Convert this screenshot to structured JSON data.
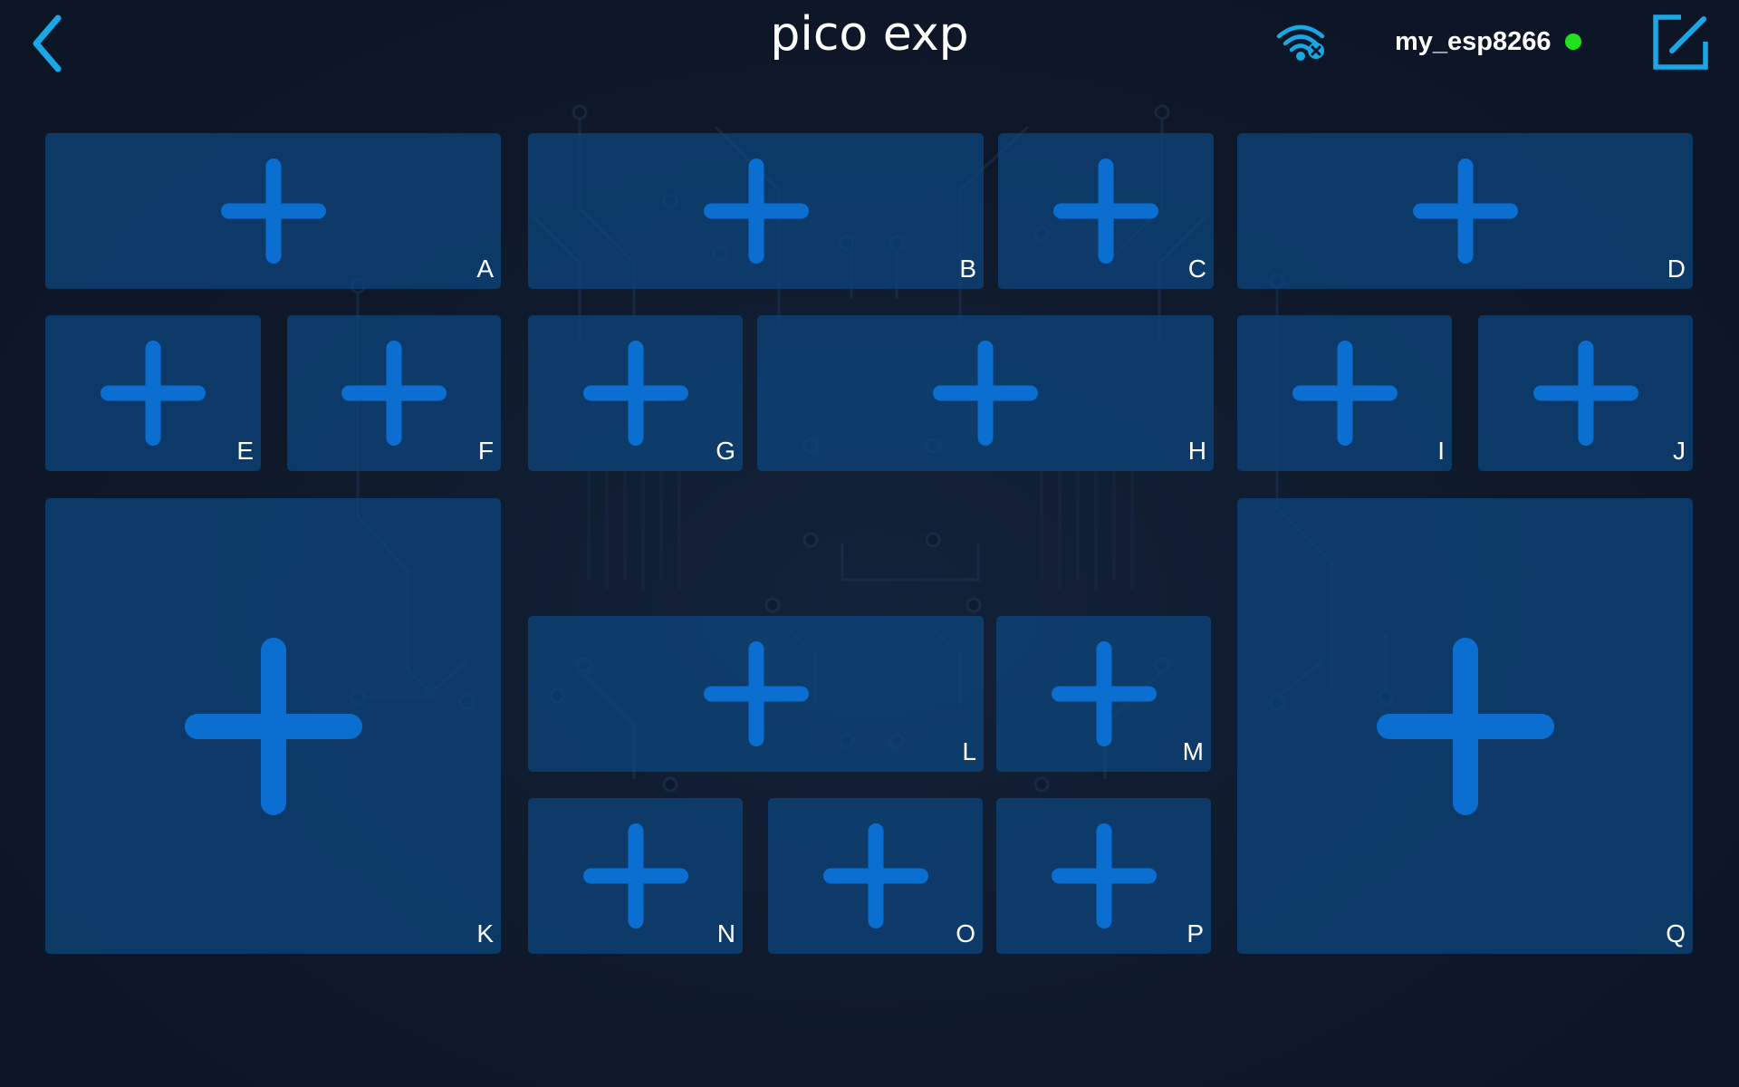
{
  "header": {
    "title": "pico exp",
    "device_name": "my_esp8266",
    "wifi_icon": "wifi-disconnected-icon",
    "back_icon": "chevron-left-icon",
    "edit_icon": "edit-square-icon"
  },
  "colors": {
    "background": "#0e1829",
    "slot": "#0c4680",
    "plus": "#0b6fd1",
    "accent": "#1aa7e6",
    "status_ok": "#1ee21a"
  },
  "slots": {
    "A": "A",
    "B": "B",
    "C": "C",
    "D": "D",
    "E": "E",
    "F": "F",
    "G": "G",
    "H": "H",
    "I": "I",
    "J": "J",
    "K": "K",
    "L": "L",
    "M": "M",
    "N": "N",
    "O": "O",
    "P": "P",
    "Q": "Q"
  }
}
